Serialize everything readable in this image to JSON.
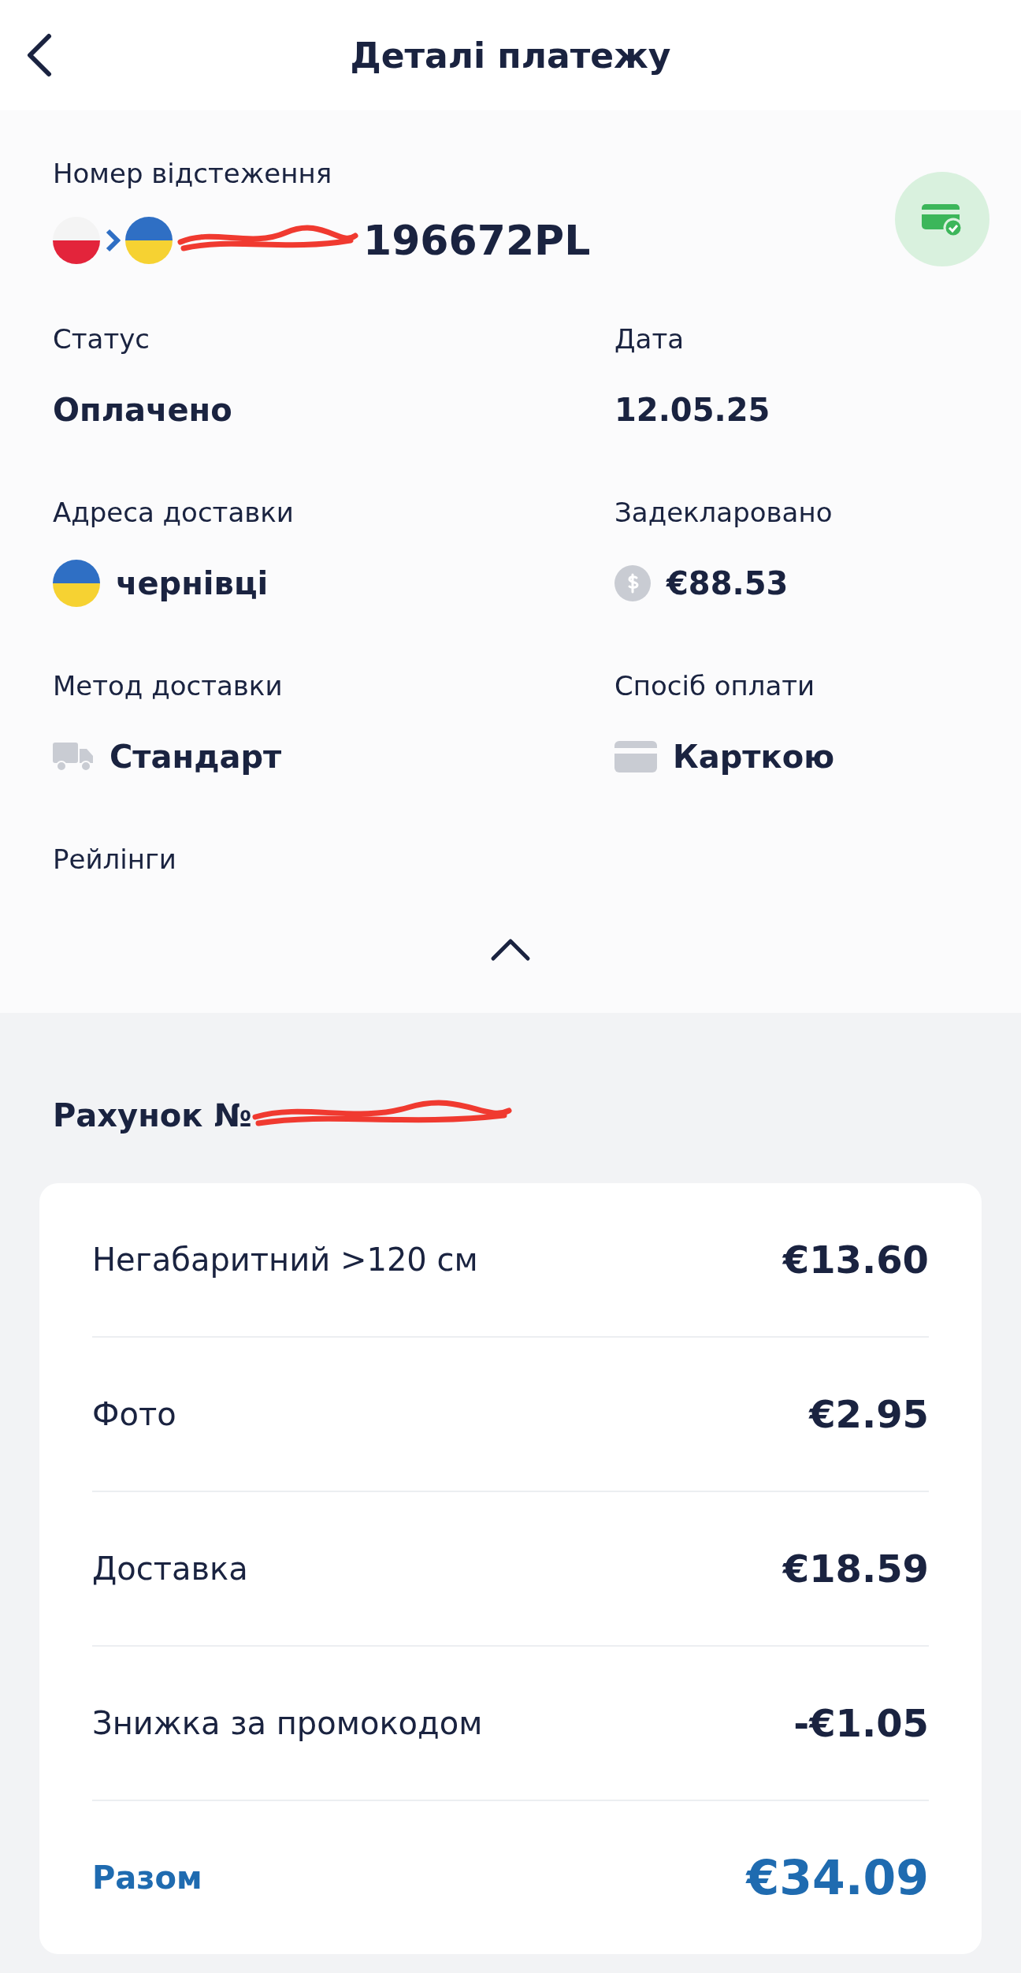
{
  "header": {
    "title": "Деталі платежу"
  },
  "tracking": {
    "label": "Номер відстеження",
    "number": "196672PL",
    "redacted": true
  },
  "fields": [
    {
      "label": "Статус",
      "value": "Оплачено"
    },
    {
      "label": "Дата",
      "value": "12.05.25"
    },
    {
      "label": "Адреса доставки",
      "value": "чернівці",
      "kind": "flag"
    },
    {
      "label": "Задекларовано",
      "value": "€88.53",
      "kind": "money"
    },
    {
      "label": "Метод доставки",
      "value": "Стандарт",
      "kind": "delivery"
    },
    {
      "label": "Спосіб оплати",
      "value": "Карткою",
      "kind": "payment"
    }
  ],
  "railings": {
    "label": "Рейлінги",
    "expanded": true
  },
  "invoice": {
    "title": "Рахунок №",
    "redacted": true,
    "rows": [
      {
        "label": "Негабаритний >120 см",
        "amount": "€13.60",
        "kind": "item"
      },
      {
        "label": "Фото",
        "amount": "€2.95",
        "kind": "item"
      },
      {
        "label": "Доставка",
        "amount": "€18.59",
        "kind": "item"
      },
      {
        "label": "Знижка за промокодом",
        "amount": "-€1.05",
        "kind": "item"
      },
      {
        "label": "Разом",
        "amount": "€34.09",
        "kind": "total"
      }
    ]
  }
}
